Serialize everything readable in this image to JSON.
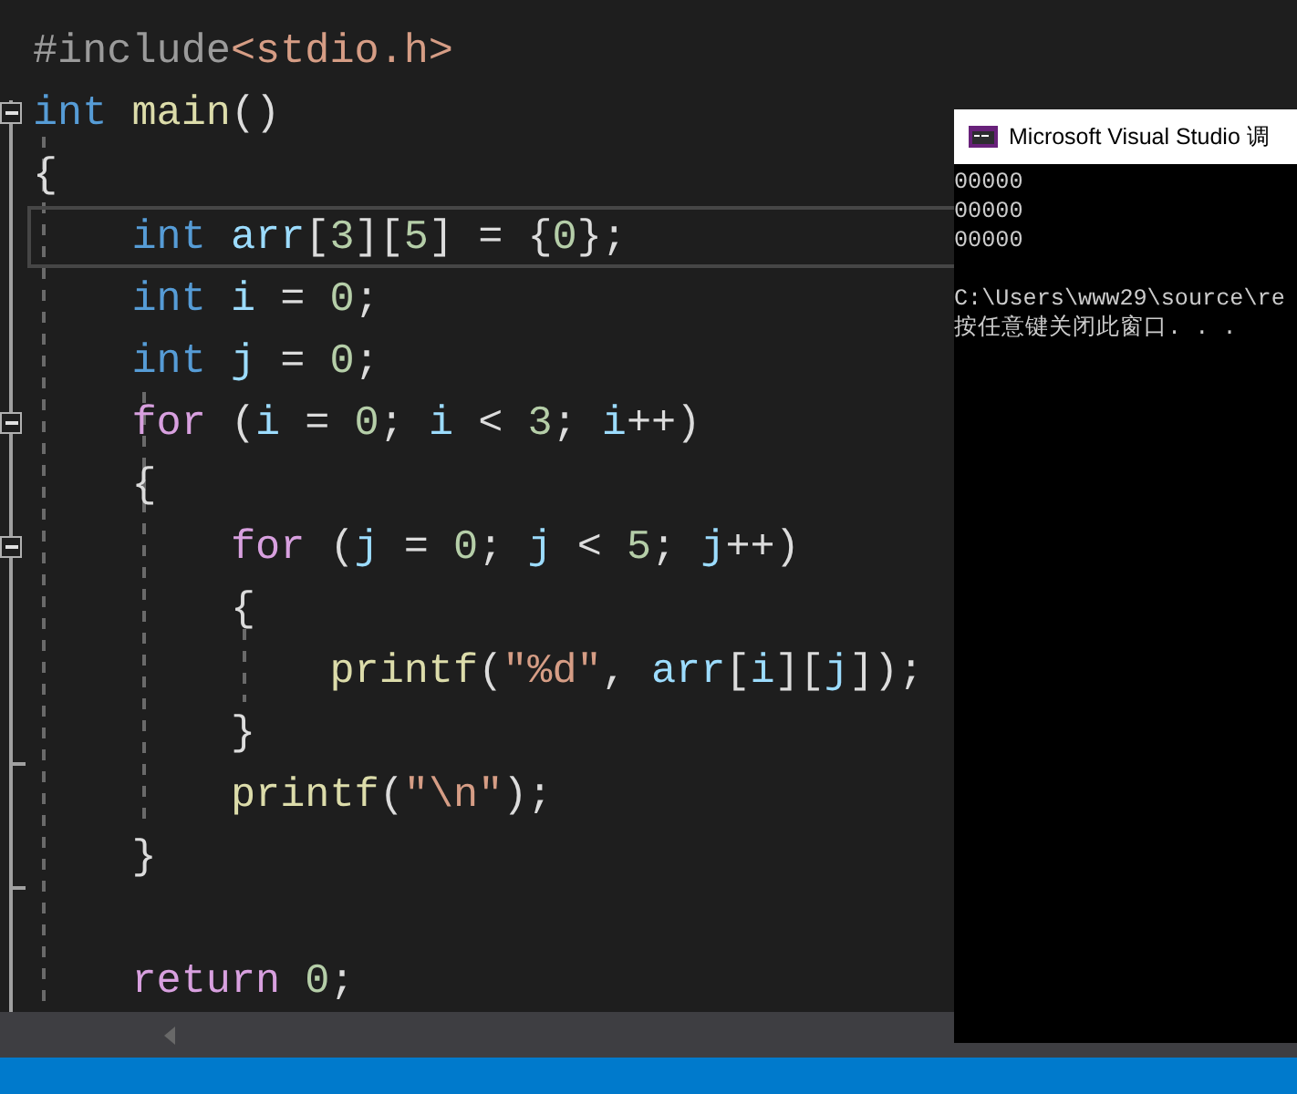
{
  "editor": {
    "lines": [
      {
        "fold_toggle": false,
        "current": false,
        "tokens": [
          {
            "kind": "preproc",
            "text": "#include"
          },
          {
            "kind": "string",
            "text": "<stdio.h>"
          }
        ]
      },
      {
        "fold_toggle": true,
        "expanded": true,
        "current": false,
        "tokens": [
          {
            "kind": "keyword",
            "text": "int"
          },
          {
            "kind": "function",
            "text": " main"
          },
          {
            "kind": "plain",
            "text": "()"
          }
        ]
      },
      {
        "fold_toggle": false,
        "current": false,
        "tokens": [
          {
            "kind": "plain",
            "text": "{"
          }
        ]
      },
      {
        "fold_toggle": false,
        "current": true,
        "tokens": [
          {
            "kind": "keyword",
            "text": "    int"
          },
          {
            "kind": "variable",
            "text": " arr"
          },
          {
            "kind": "plain",
            "text": "["
          },
          {
            "kind": "number",
            "text": "3"
          },
          {
            "kind": "plain",
            "text": "]["
          },
          {
            "kind": "number",
            "text": "5"
          },
          {
            "kind": "plain",
            "text": "] = {"
          },
          {
            "kind": "number",
            "text": "0"
          },
          {
            "kind": "plain",
            "text": "};"
          }
        ]
      },
      {
        "fold_toggle": false,
        "current": false,
        "tokens": [
          {
            "kind": "keyword",
            "text": "    int"
          },
          {
            "kind": "variable",
            "text": " i"
          },
          {
            "kind": "plain",
            "text": " = "
          },
          {
            "kind": "number",
            "text": "0"
          },
          {
            "kind": "plain",
            "text": ";"
          }
        ]
      },
      {
        "fold_toggle": false,
        "current": false,
        "tokens": [
          {
            "kind": "keyword",
            "text": "    int"
          },
          {
            "kind": "variable",
            "text": " j"
          },
          {
            "kind": "plain",
            "text": " = "
          },
          {
            "kind": "number",
            "text": "0"
          },
          {
            "kind": "plain",
            "text": ";"
          }
        ]
      },
      {
        "fold_toggle": true,
        "expanded": true,
        "current": false,
        "tokens": [
          {
            "kind": "control",
            "text": "    for"
          },
          {
            "kind": "plain",
            "text": " ("
          },
          {
            "kind": "variable",
            "text": "i"
          },
          {
            "kind": "plain",
            "text": " = "
          },
          {
            "kind": "number",
            "text": "0"
          },
          {
            "kind": "plain",
            "text": "; "
          },
          {
            "kind": "variable",
            "text": "i"
          },
          {
            "kind": "plain",
            "text": " < "
          },
          {
            "kind": "number",
            "text": "3"
          },
          {
            "kind": "plain",
            "text": "; "
          },
          {
            "kind": "variable",
            "text": "i"
          },
          {
            "kind": "plain",
            "text": "++)"
          }
        ]
      },
      {
        "fold_toggle": false,
        "current": false,
        "tokens": [
          {
            "kind": "plain",
            "text": "    {"
          }
        ]
      },
      {
        "fold_toggle": true,
        "expanded": true,
        "current": false,
        "tokens": [
          {
            "kind": "control",
            "text": "        for"
          },
          {
            "kind": "plain",
            "text": " ("
          },
          {
            "kind": "variable",
            "text": "j"
          },
          {
            "kind": "plain",
            "text": " = "
          },
          {
            "kind": "number",
            "text": "0"
          },
          {
            "kind": "plain",
            "text": "; "
          },
          {
            "kind": "variable",
            "text": "j"
          },
          {
            "kind": "plain",
            "text": " < "
          },
          {
            "kind": "number",
            "text": "5"
          },
          {
            "kind": "plain",
            "text": "; "
          },
          {
            "kind": "variable",
            "text": "j"
          },
          {
            "kind": "plain",
            "text": "++)"
          }
        ]
      },
      {
        "fold_toggle": false,
        "current": false,
        "tokens": [
          {
            "kind": "plain",
            "text": "        {"
          }
        ]
      },
      {
        "fold_toggle": false,
        "current": false,
        "tokens": [
          {
            "kind": "function",
            "text": "            printf"
          },
          {
            "kind": "plain",
            "text": "("
          },
          {
            "kind": "string",
            "text": "\"%d\""
          },
          {
            "kind": "plain",
            "text": ", "
          },
          {
            "kind": "variable",
            "text": "arr"
          },
          {
            "kind": "plain",
            "text": "["
          },
          {
            "kind": "variable",
            "text": "i"
          },
          {
            "kind": "plain",
            "text": "]["
          },
          {
            "kind": "variable",
            "text": "j"
          },
          {
            "kind": "plain",
            "text": "]);"
          }
        ]
      },
      {
        "fold_toggle": false,
        "current": false,
        "tokens": [
          {
            "kind": "plain",
            "text": "        }"
          }
        ]
      },
      {
        "fold_toggle": false,
        "current": false,
        "tokens": [
          {
            "kind": "function",
            "text": "        printf"
          },
          {
            "kind": "plain",
            "text": "("
          },
          {
            "kind": "string",
            "text": "\"\\n\""
          },
          {
            "kind": "plain",
            "text": ");"
          }
        ]
      },
      {
        "fold_toggle": false,
        "current": false,
        "tokens": [
          {
            "kind": "plain",
            "text": "    }"
          }
        ]
      },
      {
        "fold_toggle": false,
        "current": false
      },
      {
        "fold_toggle": false,
        "current": false,
        "tokens": [
          {
            "kind": "control",
            "text": "    return"
          },
          {
            "kind": "number",
            "text": " 0"
          },
          {
            "kind": "plain",
            "text": ";"
          }
        ]
      }
    ]
  },
  "console": {
    "title": "Microsoft Visual Studio 调",
    "output": [
      "00000",
      "00000",
      "00000"
    ],
    "footer": [
      "C:\\Users\\www29\\source\\re",
      "按任意键关闭此窗口. . ."
    ]
  }
}
